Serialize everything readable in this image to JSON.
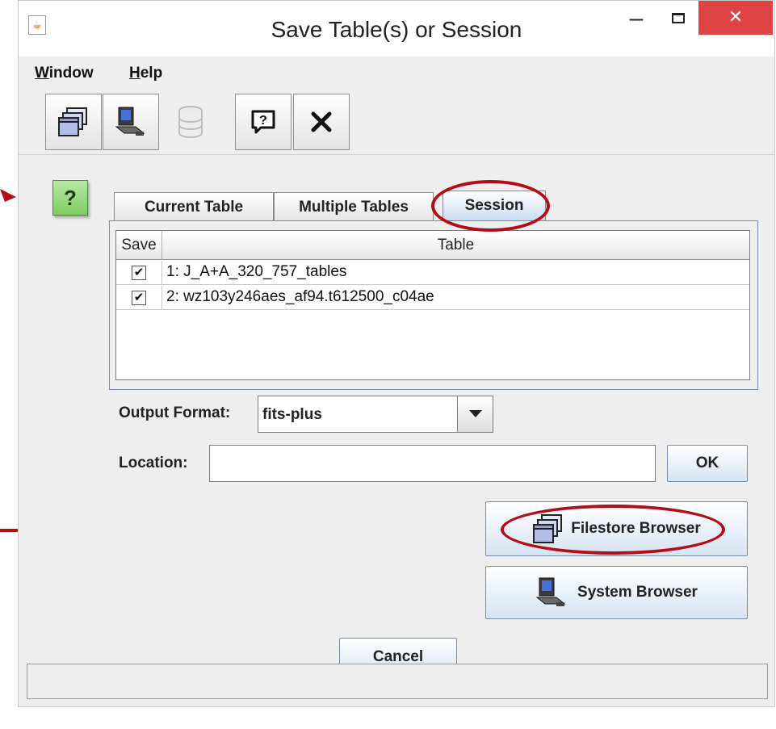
{
  "window": {
    "title": "Save Table(s) or Session"
  },
  "menubar": {
    "items": [
      {
        "mnemonic": "W",
        "rest": "indow"
      },
      {
        "mnemonic": "H",
        "rest": "elp"
      }
    ]
  },
  "toolbar": {
    "buttons": [
      {
        "icon": "filestore-window-icon",
        "enabled": true
      },
      {
        "icon": "system-browser-icon",
        "enabled": true
      },
      {
        "icon": "database-icon",
        "enabled": false
      },
      {
        "icon": "help-icon",
        "enabled": true
      },
      {
        "icon": "close-icon",
        "enabled": true
      }
    ]
  },
  "help_badge": "?",
  "tabs": [
    {
      "label": "Current Table",
      "active": false
    },
    {
      "label": "Multiple Tables",
      "active": false
    },
    {
      "label": "Session",
      "active": true
    }
  ],
  "table": {
    "columns": [
      "Save",
      "Table"
    ],
    "rows": [
      {
        "checked": true,
        "name": "1: J_A+A_320_757_tables"
      },
      {
        "checked": true,
        "name": "2: wz103y246aes_af94.t612500_c04ae"
      }
    ]
  },
  "output_format": {
    "label": "Output Format:",
    "value": "fits-plus"
  },
  "location": {
    "label": "Location:",
    "value": ""
  },
  "buttons": {
    "ok": "OK",
    "filestore_browser": "Filestore Browser",
    "system_browser": "System Browser",
    "cancel": "Cancel"
  },
  "colors": {
    "annotation": "#b50d15",
    "active_tab": "#c8dcf0",
    "button": "#d6e3f1"
  }
}
